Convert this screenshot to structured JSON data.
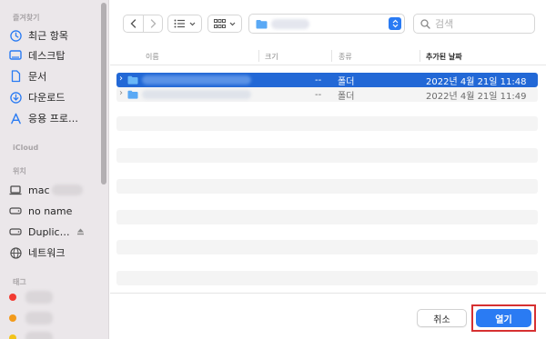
{
  "sidebar": {
    "favorites_header": "즐겨찾기",
    "favorites": [
      {
        "label": "최근 항목",
        "icon": "clock-icon"
      },
      {
        "label": "데스크탑",
        "icon": "desktop-icon"
      },
      {
        "label": "문서",
        "icon": "document-icon"
      },
      {
        "label": "다운로드",
        "icon": "download-icon"
      },
      {
        "label": "응용 프로…",
        "icon": "applications-icon"
      }
    ],
    "icloud_header": "iCloud",
    "locations_header": "위치",
    "locations": [
      {
        "label": "mac",
        "icon": "laptop-icon"
      },
      {
        "label": "no name",
        "icon": "drive-icon"
      },
      {
        "label": "Duplic…",
        "icon": "drive-icon"
      },
      {
        "label": "네트워크",
        "icon": "network-icon"
      }
    ],
    "tags_header": "태그",
    "tag_colors": [
      "#f23b32",
      "#f29a1b",
      "#f2c31b"
    ]
  },
  "toolbar": {
    "search_placeholder": "검색",
    "colors": {
      "accent": "#2a7bf3"
    }
  },
  "columns": {
    "name": "이름",
    "size": "크기",
    "kind": "종류",
    "date_added": "추가된 날짜"
  },
  "rows": [
    {
      "size": "--",
      "kind": "폴더",
      "date": "2022년 4월 21일 11:48",
      "selected": true
    },
    {
      "size": "--",
      "kind": "폴더",
      "date": "2022년 4월 21일 11:49",
      "selected": false
    }
  ],
  "footer": {
    "cancel_label": "취소",
    "open_label": "열기"
  }
}
